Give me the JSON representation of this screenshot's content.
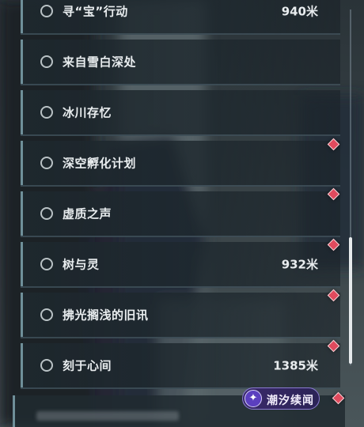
{
  "quests": [
    {
      "title": "寻“宝”行动",
      "distance": "940米"
    },
    {
      "title": "来自雪白深处",
      "distance": ""
    },
    {
      "title": "冰川存忆",
      "distance": ""
    },
    {
      "title": "深空孵化计划",
      "distance": ""
    },
    {
      "title": "虚质之声",
      "distance": ""
    },
    {
      "title": "树与灵",
      "distance": "932米"
    },
    {
      "title": "拂光搁浅的旧讯",
      "distance": ""
    },
    {
      "title": "刻于心间",
      "distance": "1385米"
    }
  ],
  "watermark": {
    "text": "潮汐续闻"
  },
  "colors": {
    "marker": "#e04a5d",
    "accent": "#6f8f99",
    "text": "#e9edef"
  }
}
